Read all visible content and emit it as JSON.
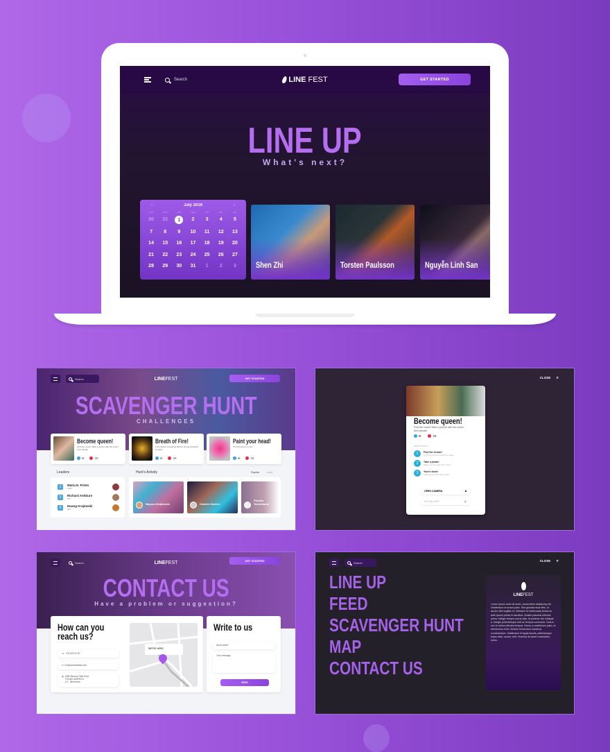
{
  "brand": {
    "name_bold": "LINE",
    "name_light": "FEST"
  },
  "nav": {
    "search_placeholder": "Search",
    "cta": "GET STARTED",
    "close": "CLOSE"
  },
  "lineup": {
    "title": "LINE UP",
    "subtitle": "What's next?",
    "calendar": {
      "month": "July 2019",
      "weekdays": [
        "SUN",
        "MON",
        "TUE",
        "WED",
        "THU",
        "FRI",
        "SAT"
      ],
      "selected_day": "1",
      "weeks": [
        [
          "30",
          "31",
          "1",
          "2",
          "3",
          "4",
          "5"
        ],
        [
          "7",
          "8",
          "9",
          "10",
          "11",
          "12",
          "13"
        ],
        [
          "14",
          "15",
          "16",
          "17",
          "18",
          "19",
          "20"
        ],
        [
          "21",
          "22",
          "23",
          "24",
          "25",
          "26",
          "27"
        ],
        [
          "28",
          "29",
          "30",
          "31",
          "1",
          "2",
          "3"
        ]
      ]
    },
    "artists": [
      "Shen Zhi",
      "Torsten Paulsson",
      "Nguyễn Linh San"
    ]
  },
  "scavenger": {
    "title": "SCAVENGER HUNT",
    "subtitle": "CHALLENGES",
    "challenges": [
      {
        "title": "Become queen!",
        "desc": "Find the crown! Take a picture with the crown. And upload!",
        "likes": "99",
        "points": "133"
      },
      {
        "title": "Breath of Fire!",
        "desc": "A fire dancer breathing flames during a festival at night!",
        "likes": "99",
        "points": "133"
      },
      {
        "title": "Paint your head!",
        "desc": "It'll look good on you!",
        "likes": "99",
        "points": "133"
      }
    ],
    "leaders_label": "Leaders",
    "leaders": [
      {
        "rank": "1",
        "name": "Maria E. Prieto",
        "score": "1280"
      },
      {
        "rank": "2",
        "name": "Richard Ashburn",
        "score": "972"
      },
      {
        "rank": "3",
        "name": "Hoang Krajewski",
        "score": "844"
      }
    ],
    "activity_label": "Hunt's Activity",
    "activity_tabs": [
      "Popular",
      "Latest"
    ],
    "activity": [
      {
        "name": "Nayara Delafuente",
        "time": "2 hours ago"
      },
      {
        "name": "Charles Davies",
        "time": "2 hours ago"
      },
      {
        "name": "Phoebe Tanenbaum",
        "time": "2 hours ago"
      }
    ]
  },
  "modal": {
    "title": "Become queen!",
    "desc": "Find the crown! Take a picture with the crown. And upload!",
    "likes": "99",
    "points": "133",
    "how_label": "HOW TO PLAY?",
    "steps": [
      {
        "n": "1",
        "title": "Find the Crown!",
        "desc": "In front of the tree behind the stage"
      },
      {
        "n": "2",
        "title": "Take a photo!",
        "desc": "Make sure you wear the crown :)"
      },
      {
        "n": "3",
        "title": "You're done!",
        "desc": "Upload photo and earn points!"
      }
    ],
    "open_camera": "OPEN CAMERA",
    "gallery": "MY GALLERY"
  },
  "contact": {
    "title": "CONTACT US",
    "subtitle": "Have a problem or suggestion?",
    "reach_title_1": "How can you",
    "reach_title_2": "reach us?",
    "phone": "+00 878 00 00",
    "email": "info@onelandfest.com",
    "address": [
      "4380 Benson Park Drive",
      "YOUNG AMERICA",
      "LO - Minnesota"
    ],
    "map_label": "WE'RE HERE",
    "write_title": "Write to us",
    "about_placeholder": "About what?",
    "message_placeholder": "Your message...",
    "send": "SEND"
  },
  "menu": {
    "items": [
      "LINE UP",
      "FEED",
      "SCAVENGER HUNT",
      "MAP",
      "CONTACT US"
    ],
    "about_text": "Lorem ipsum dolor sit amet, consectetur adipiscing elit. Vestibulum ut cursus justo. Sed gravida risus felis, id auctor nibh sagittis et. Interdum et malesuada fames ac ante ipsum primis in faucibus. Nullam placerat ultricies purus. Integer tempor purus odio, id pulvinar nisi volutpat a. Integer pellentesque velit ac tempus commodo. Duis in orci id metus ultricies tempus. Donec a vestibulum justo, et elementum enim. Nullam fermentum maximus condimentum. Vestibulum et ligula iaculis, pellentesque turpis vitae, auctor velit. Vivamus sit amet consectetur lorem."
  }
}
